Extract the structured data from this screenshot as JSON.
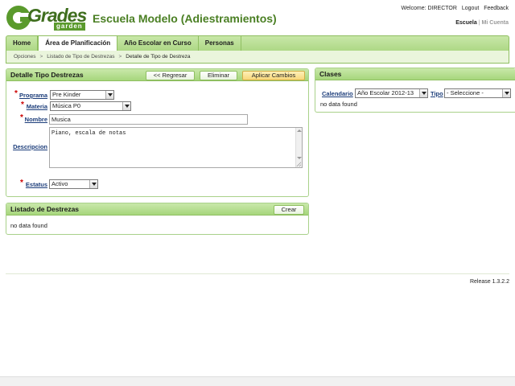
{
  "header": {
    "logo_word": "Grades",
    "logo_sub": "garden",
    "school_title": "Escuela Modelo (Adiestramientos)",
    "welcome": "Welcome: DIRECTOR",
    "logout": "Logout",
    "feedback": "Feedback",
    "context_active": "Escuela",
    "context_sep": "|",
    "context_inactive": "Mi Cuenta"
  },
  "nav": {
    "tabs": [
      {
        "label": "Home"
      },
      {
        "label": "Área de Planificación"
      },
      {
        "label": "Año Escolar en Curso"
      },
      {
        "label": "Personas"
      }
    ]
  },
  "breadcrumb": {
    "items": [
      "Opciones",
      "Listado de Tipo de Destrezas",
      "Detalle de Tipo de Destreza"
    ],
    "arrow": ">"
  },
  "detalle": {
    "title": "Detalle Tipo Destrezas",
    "back_button": "<< Regresar",
    "delete_button": "Eliminar",
    "apply_button": "Aplicar Cambios",
    "required_mark": "*",
    "programa_label": "Programa",
    "programa_value": "Pre Kinder",
    "materia_label": "Materia",
    "materia_value": "Música P0",
    "nombre_label": "Nombre",
    "nombre_value": "Musica",
    "descripcion_label": "Descripcion",
    "descripcion_value": "Piano, escala de notas",
    "estatus_label": "Estatus",
    "estatus_value": "Activo"
  },
  "destrezas": {
    "title": "Listado de Destrezas",
    "create_button": "Crear",
    "empty_text": "no data found"
  },
  "clases": {
    "title": "Clases",
    "calendario_label": "Calendario",
    "calendario_value": "Año Escolar 2012-13",
    "tipo_label": "Tipo",
    "tipo_value": "- Seleccione -",
    "empty_text": "no data found"
  },
  "footer": {
    "release": "Release 1.3.2.2"
  },
  "colors": {
    "brand_green": "#4a7f23",
    "tab_green": "#aed886",
    "link_blue": "#1c3d7a",
    "required_red": "#cc0000",
    "primary_button": "#f7d77a"
  }
}
